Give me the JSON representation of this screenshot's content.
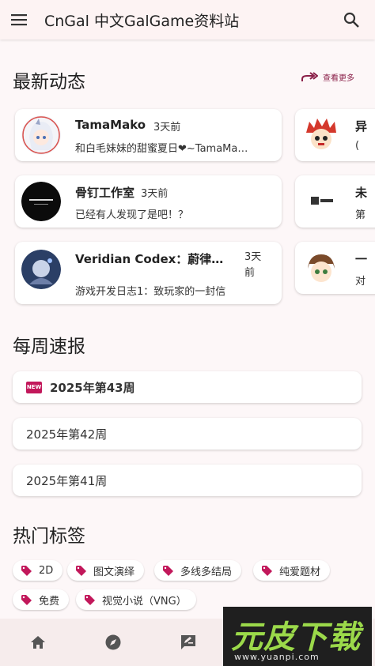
{
  "app_bar": {
    "title": "CnGal 中文GalGame资料站",
    "menu_icon": "menu-icon",
    "search_icon": "search-icon"
  },
  "latest": {
    "title": "最新动态",
    "more_label": "查看更多",
    "cards": [
      {
        "name": "TamaMako",
        "time": "3天前",
        "text": "和白毛妹妹的甜蜜夏日❤~TamaMa…"
      },
      {
        "name": "骨钉工作室",
        "time": "3天前",
        "text": "已经有人发现了是吧！？"
      },
      {
        "name": "Veridian Codex：蔚律…",
        "time": "3天前",
        "text": "游戏开发日志1：致玩家的一封信"
      }
    ],
    "side_cards": [
      {
        "name": "异",
        "text": "("
      },
      {
        "name": "未",
        "text": "第"
      },
      {
        "name": "一",
        "text": "对"
      }
    ]
  },
  "weekly": {
    "title": "每周速报",
    "badge": "NEW",
    "items": [
      "2025年第43周",
      "2025年第42周",
      "2025年第41周"
    ]
  },
  "tags": {
    "title": "热门标签",
    "items": [
      "2D",
      "图文演绎",
      "多线多结局",
      "纯爱题材",
      "免费",
      "视觉小说（VNG）"
    ]
  },
  "nav": {
    "items": [
      "home-icon",
      "explore-icon",
      "feedback-icon"
    ]
  },
  "watermark": {
    "text": "元皮下载",
    "url": "www.yuanpi.com"
  },
  "colors": {
    "accent": "#c2185b",
    "more_link": "#8a1f48",
    "background": "#fdf7f8"
  }
}
